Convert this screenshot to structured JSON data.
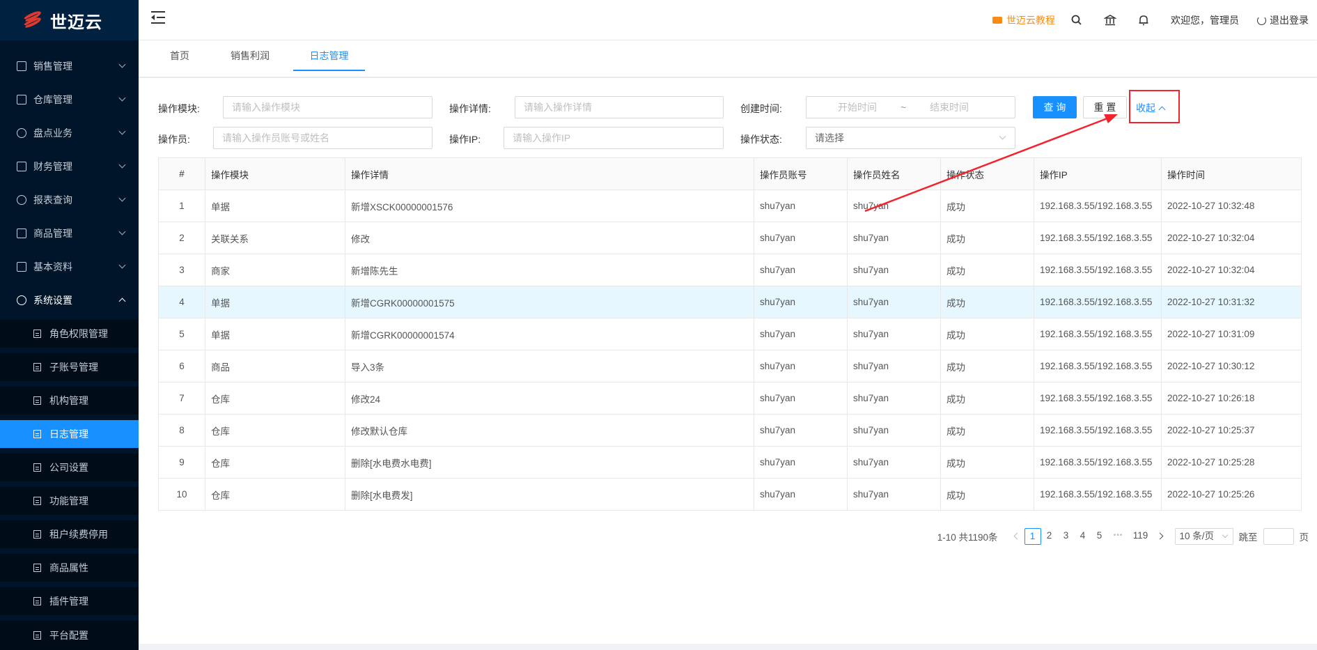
{
  "app": {
    "logo_text": "世迈云"
  },
  "sidebar": {
    "menus": [
      {
        "label": "销售管理",
        "icon": "cart-icon"
      },
      {
        "label": "仓库管理",
        "icon": "warehouse-icon"
      },
      {
        "label": "盘点业务",
        "icon": "gauge-icon"
      },
      {
        "label": "财务管理",
        "icon": "money-icon"
      },
      {
        "label": "报表查询",
        "icon": "pie-icon"
      },
      {
        "label": "商品管理",
        "icon": "bag-icon"
      },
      {
        "label": "基本资料",
        "icon": "grid-icon"
      },
      {
        "label": "系统设置",
        "icon": "gear-icon"
      }
    ],
    "sub_items": [
      "角色权限管理",
      "子账号管理",
      "机构管理",
      "日志管理",
      "公司设置",
      "功能管理",
      "租户续费停用",
      "商品属性",
      "插件管理",
      "平台配置"
    ]
  },
  "header": {
    "tutorial": "世迈云教程",
    "welcome": "欢迎您，管理员",
    "logout": "退出登录"
  },
  "tabs": [
    "首页",
    "销售利润",
    "日志管理"
  ],
  "filters": {
    "module_label": "操作模块:",
    "module_placeholder": "请输入操作模块",
    "detail_label": "操作详情:",
    "detail_placeholder": "请输入操作详情",
    "created_label": "创建时间:",
    "start_placeholder": "开始时间",
    "range_sep": "~",
    "end_placeholder": "结束时间",
    "operator_label": "操作员:",
    "operator_placeholder": "请输入操作员账号或姓名",
    "ip_label": "操作IP:",
    "ip_placeholder": "请输入操作IP",
    "status_label": "操作状态:",
    "status_placeholder": "请选择",
    "query_btn": "查 询",
    "reset_btn": "重 置",
    "collapse": "收起"
  },
  "table": {
    "headers": [
      "#",
      "操作模块",
      "操作详情",
      "操作员账号",
      "操作员姓名",
      "操作状态",
      "操作IP",
      "操作时间"
    ],
    "rows": [
      [
        "1",
        "单据",
        "新增XSCK00000001576",
        "shu7yan",
        "shu7yan",
        "成功",
        "192.168.3.55/192.168.3.55",
        "2022-10-27 10:32:48"
      ],
      [
        "2",
        "关联关系",
        "修改",
        "shu7yan",
        "shu7yan",
        "成功",
        "192.168.3.55/192.168.3.55",
        "2022-10-27 10:32:04"
      ],
      [
        "3",
        "商家",
        "新增陈先生",
        "shu7yan",
        "shu7yan",
        "成功",
        "192.168.3.55/192.168.3.55",
        "2022-10-27 10:32:04"
      ],
      [
        "4",
        "单据",
        "新增CGRK00000001575",
        "shu7yan",
        "shu7yan",
        "成功",
        "192.168.3.55/192.168.3.55",
        "2022-10-27 10:31:32"
      ],
      [
        "5",
        "单据",
        "新增CGRK00000001574",
        "shu7yan",
        "shu7yan",
        "成功",
        "192.168.3.55/192.168.3.55",
        "2022-10-27 10:31:09"
      ],
      [
        "6",
        "商品",
        "导入3条",
        "shu7yan",
        "shu7yan",
        "成功",
        "192.168.3.55/192.168.3.55",
        "2022-10-27 10:30:12"
      ],
      [
        "7",
        "仓库",
        "修改24",
        "shu7yan",
        "shu7yan",
        "成功",
        "192.168.3.55/192.168.3.55",
        "2022-10-27 10:26:18"
      ],
      [
        "8",
        "仓库",
        "修改默认仓库",
        "shu7yan",
        "shu7yan",
        "成功",
        "192.168.3.55/192.168.3.55",
        "2022-10-27 10:25:37"
      ],
      [
        "9",
        "仓库",
        "删除[水电费水电费]",
        "shu7yan",
        "shu7yan",
        "成功",
        "192.168.3.55/192.168.3.55",
        "2022-10-27 10:25:28"
      ],
      [
        "10",
        "仓库",
        "删除[水电费发]",
        "shu7yan",
        "shu7yan",
        "成功",
        "192.168.3.55/192.168.3.55",
        "2022-10-27 10:25:26"
      ]
    ]
  },
  "pagination": {
    "total_text": "1-10 共1190条",
    "pages": [
      "1",
      "2",
      "3",
      "4",
      "5"
    ],
    "ellipsis": "•••",
    "last_page": "119",
    "page_size": "10 条/页",
    "jump_label": "跳至",
    "page_suffix": "页"
  },
  "colors": {
    "accent": "#1890ff",
    "sidebar": "#001529",
    "annotation": "#f5222d",
    "tutorial": "#fa8c16"
  }
}
